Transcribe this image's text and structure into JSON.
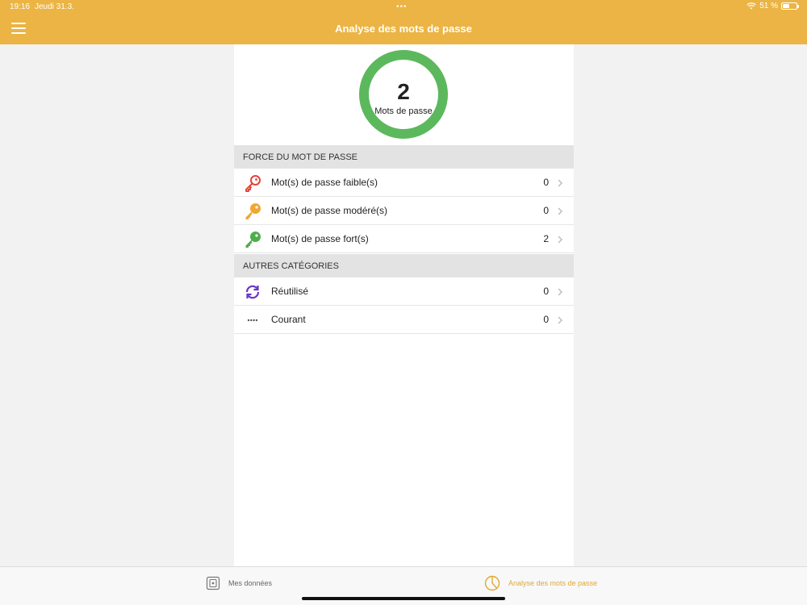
{
  "status_bar": {
    "time": "19:16",
    "date": "Jeudi 31.3.",
    "battery": "51 %",
    "battery_level": 0.51
  },
  "header": {
    "title": "Analyse des mots de passe",
    "menu_icon": "hamburger-icon"
  },
  "summary": {
    "count": "2",
    "label": "Mots de passe",
    "ring_color": "#5cb85c"
  },
  "strength_section": {
    "title": "FORCE DU MOT DE PASSE",
    "items": [
      {
        "label": "Mot(s) de passe faible(s)",
        "count": "0",
        "icon": "key-red-icon",
        "color": "#e3443a"
      },
      {
        "label": "Mot(s) de passe modéré(s)",
        "count": "0",
        "icon": "key-orange-icon",
        "color": "#f0a830"
      },
      {
        "label": "Mot(s) de passe fort(s)",
        "count": "2",
        "icon": "key-green-icon",
        "color": "#4cae4c"
      }
    ]
  },
  "other_section": {
    "title": "AUTRES CATÉGORIES",
    "items": [
      {
        "label": "Réutilisé",
        "count": "0",
        "icon": "refresh-icon",
        "color": "#6a35c8"
      },
      {
        "label": "Courant",
        "count": "0",
        "icon": "password-dots-icon",
        "color": "#555555"
      }
    ]
  },
  "tabbar": {
    "tabs": [
      {
        "label": "Mes données",
        "icon": "vault-icon",
        "active": false
      },
      {
        "label": "Analyse des mots de passe",
        "icon": "analysis-clock-icon",
        "active": true
      }
    ]
  },
  "colors": {
    "accent": "#ebb444",
    "active_tab": "#e3a830"
  }
}
